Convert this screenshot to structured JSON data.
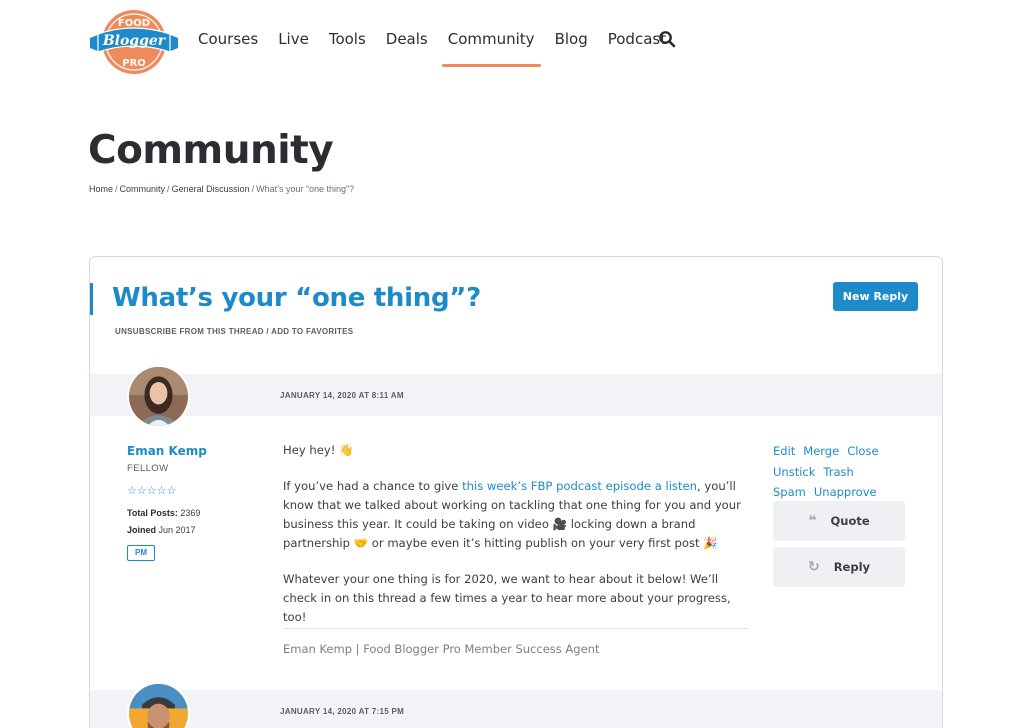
{
  "brand": {
    "logo_text": [
      "FOOD",
      "Blogger",
      "PRO"
    ],
    "colors": {
      "orange": "#ee8a5b",
      "blue": "#1d8ac9",
      "dark": "#2b2d33"
    }
  },
  "nav": {
    "items": [
      {
        "label": "Courses"
      },
      {
        "label": "Live"
      },
      {
        "label": "Tools"
      },
      {
        "label": "Deals"
      },
      {
        "label": "Community",
        "active": true
      },
      {
        "label": "Blog"
      },
      {
        "label": "Podcast"
      }
    ],
    "search_icon": "search-icon"
  },
  "page": {
    "title": "Community",
    "breadcrumb": [
      "Home",
      "Community",
      "General Discussion",
      "What’s your “one thing”?"
    ]
  },
  "thread": {
    "title": "What’s your “one thing”?",
    "new_reply_label": "New Reply",
    "unsubscribe_label": "UNSUBSCRIBE FROM THIS THREAD",
    "favorites_label": "ADD TO FAVORITES"
  },
  "posts": [
    {
      "date": "JANUARY 14, 2020 AT 8:11 AM",
      "author": {
        "name": "Eman Kemp",
        "role": "FELLOW",
        "stars": "☆☆☆☆☆",
        "total_posts_label": "Total Posts:",
        "total_posts": "2369",
        "joined_label": "Joined",
        "joined": "Jun 2017",
        "pm_label": "PM"
      },
      "body": {
        "greeting": "Hey hey! 👋",
        "p2_before": "If you’ve had a chance to give ",
        "p2_link": "this week’s FBP podcast episode a listen",
        "p2_after": ", you’ll know that we talked about working on tackling that one thing for you and your business this year. It could be taking on video 🎥 locking down a brand partnership 🤝 or maybe even it’s hitting publish on your very first post 🎉",
        "p3": "Whatever your one thing is for 2020, we want to hear about it below! We’ll check in on this thread a few times a year to hear more about your progress, too!"
      },
      "signature": "Eman Kemp | Food Blogger Pro Member Success Agent",
      "admin_links": [
        "Edit",
        "Merge",
        "Close",
        "Unstick",
        "Trash",
        "Spam",
        "Unapprove"
      ],
      "quote_label": "Quote",
      "reply_label": "Reply"
    },
    {
      "date": "JANUARY 14, 2020 AT 7:15 PM"
    }
  ]
}
